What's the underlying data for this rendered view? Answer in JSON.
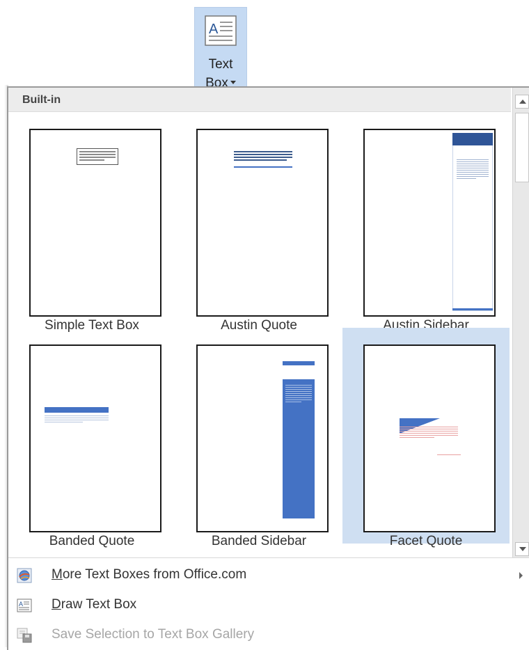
{
  "ribbon": {
    "button_line1": "Text",
    "button_line2": "Box",
    "icon": "text-box-icon"
  },
  "dropdown": {
    "section_header": "Built-in",
    "gallery": [
      {
        "label": "Simple Text Box",
        "selected": false
      },
      {
        "label": "Austin Quote",
        "selected": false
      },
      {
        "label": "Austin Sidebar",
        "selected": false
      },
      {
        "label": "Banded Quote",
        "selected": false
      },
      {
        "label": "Banded Sidebar",
        "selected": false
      },
      {
        "label": "Facet Quote",
        "selected": true
      }
    ],
    "menu": [
      {
        "access_key": "M",
        "rest": "ore Text Boxes from Office.com",
        "icon": "office-globe-icon",
        "submenu": true,
        "enabled": true
      },
      {
        "access_key": "D",
        "rest": "raw Text Box",
        "icon": "draw-text-box-icon",
        "submenu": false,
        "enabled": true
      },
      {
        "access_key": "",
        "rest": "Save Selection to Text Box Gallery",
        "icon": "save-to-gallery-icon",
        "submenu": false,
        "enabled": false
      }
    ]
  },
  "colors": {
    "accent_blue": "#4472c4",
    "selection_bg": "#cfdff2",
    "facet_red": "#e8a0a0"
  }
}
